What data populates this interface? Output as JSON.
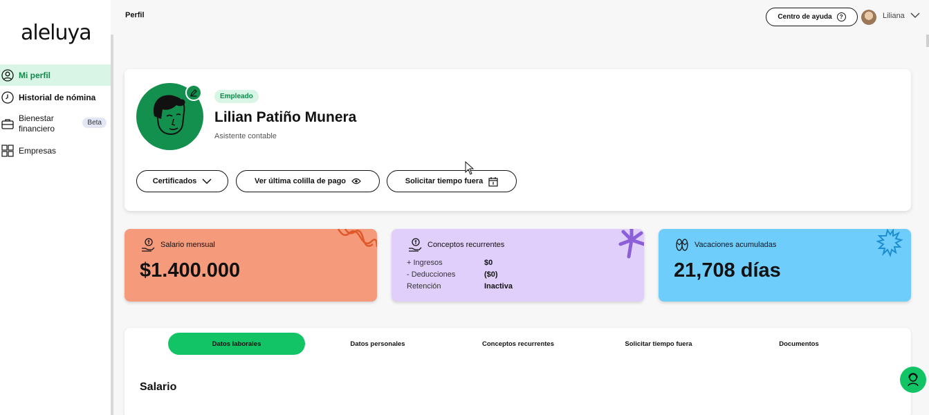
{
  "brand": {
    "logo_text": "aleluya"
  },
  "sidebar": {
    "items": [
      {
        "label": "Mi perfil",
        "icon": "user-circle-icon",
        "active": true
      },
      {
        "label": "Historial de nómina",
        "icon": "clock-icon"
      },
      {
        "label": "Bienestar financiero",
        "icon": "briefcase-icon",
        "badge": "Beta"
      },
      {
        "label": "Empresas",
        "icon": "grid-icon"
      }
    ]
  },
  "header": {
    "page_title": "Perfil",
    "help_label": "Centro de ayuda",
    "user_name": "Liliana"
  },
  "profile": {
    "role_badge": "Empleado",
    "full_name": "Lilian Patiño Munera",
    "job_title": "Asistente contable",
    "actions": {
      "certificates": "Certificados",
      "last_payslip": "Ver última colilla de pago",
      "request_time_off": "Solicitar tiempo fuera"
    }
  },
  "stats": {
    "salary": {
      "label": "Salario mensual",
      "value": "$1.400.000",
      "color": "#f59b7c"
    },
    "recurring": {
      "label": "Conceptos recurrentes",
      "color": "#e0cffa",
      "rows": [
        {
          "label": "+ Ingresos",
          "value": "$0"
        },
        {
          "label": "- Deducciones",
          "value": "($0)"
        },
        {
          "label": "Retención",
          "value": "Inactiva"
        }
      ]
    },
    "vacation": {
      "label": "Vacaciones acumuladas",
      "value": "21,708 días",
      "color": "#6fcdfc"
    }
  },
  "tabs": [
    {
      "label": "Datos laborales",
      "active": true
    },
    {
      "label": "Datos personales"
    },
    {
      "label": "Conceptos recurrentes"
    },
    {
      "label": "Solicitar tiempo fuera"
    },
    {
      "label": "Documentos"
    }
  ],
  "section": {
    "title": "Salario"
  },
  "colors": {
    "accent": "#12c466",
    "accent_dark": "#13904d",
    "active_bg": "#d8f5e6"
  }
}
